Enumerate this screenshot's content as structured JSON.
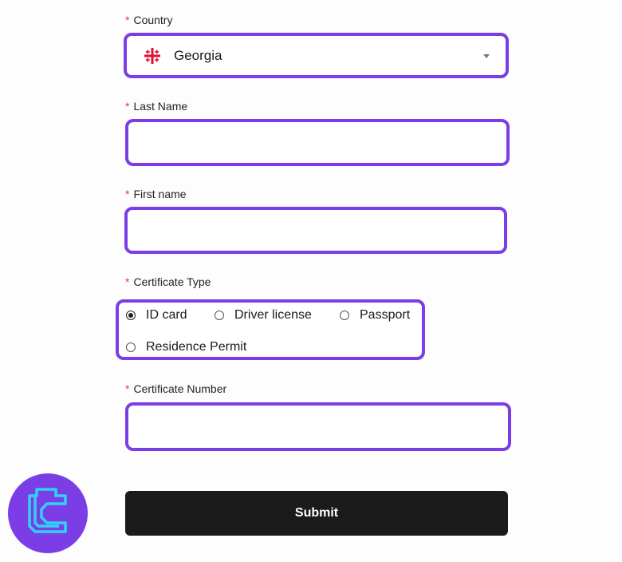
{
  "form": {
    "required_mark": "*",
    "country": {
      "label": "Country",
      "selected": "Georgia",
      "flag_icon": "georgia-flag-icon"
    },
    "last_name": {
      "label": "Last Name",
      "value": "",
      "placeholder": ""
    },
    "first_name": {
      "label": "First name",
      "value": "",
      "placeholder": ""
    },
    "certificate_type": {
      "label": "Certificate Type",
      "options": [
        "ID card",
        "Driver license",
        "Passport",
        "Residence Permit"
      ],
      "selected": "ID card"
    },
    "certificate_number": {
      "label": "Certificate Number",
      "value": "",
      "placeholder": ""
    },
    "submit_label": "Submit"
  },
  "colors": {
    "accent": "#7b3ee6",
    "required": "#e53935",
    "button_bg": "#1b1b1b",
    "logo_line": "#2fd3f5"
  },
  "icons": {
    "logo": "tc-logo-icon",
    "caret": "caret-down-icon"
  }
}
